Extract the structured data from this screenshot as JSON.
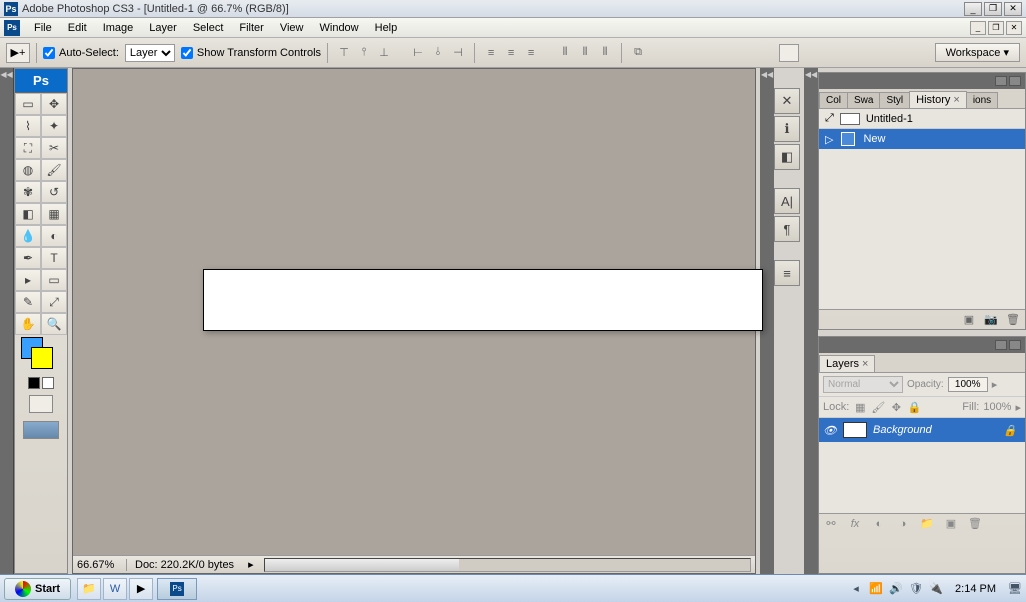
{
  "titlebar": {
    "app_icon": "Ps",
    "title": "Adobe Photoshop CS3 - [Untitled-1 @ 66.7% (RGB/8)]"
  },
  "menubar": {
    "items": [
      "File",
      "Edit",
      "Image",
      "Layer",
      "Select",
      "Filter",
      "View",
      "Window",
      "Help"
    ]
  },
  "optionsbar": {
    "auto_select_label": "Auto-Select:",
    "auto_select_value": "Layer",
    "show_transform_label": "Show Transform Controls",
    "workspace_label": "Workspace ▾"
  },
  "toolbox": {
    "logo": "Ps"
  },
  "canvas": {
    "zoom": "66.67%",
    "doc_info": "Doc: 220.2K/0 bytes"
  },
  "palette_tabs": {
    "history": [
      "Col",
      "Swa",
      "Styl",
      "History",
      "ions"
    ],
    "layers": [
      "Layers"
    ]
  },
  "history": {
    "doc_name": "Untitled-1",
    "item": "New"
  },
  "layers": {
    "blend_mode": "Normal",
    "opacity_label": "Opacity:",
    "opacity_value": "100%",
    "lock_label": "Lock:",
    "fill_label": "Fill:",
    "fill_value": "100%",
    "layer_name": "Background"
  },
  "taskbar": {
    "start": "Start",
    "clock": "2:14 PM"
  }
}
